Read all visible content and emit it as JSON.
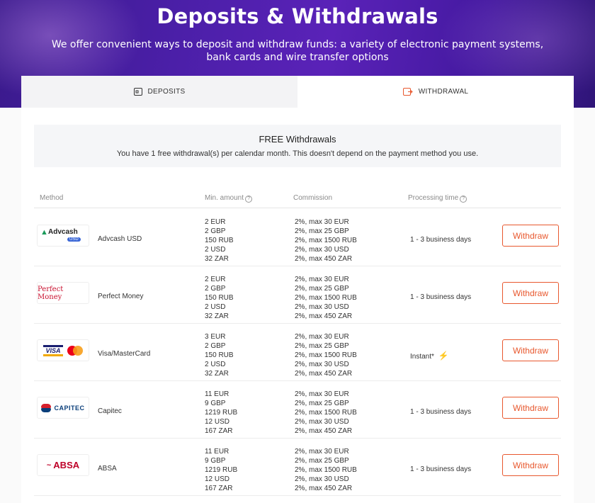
{
  "hero": {
    "title": "Deposits & Withdrawals",
    "subtitle": "We offer convenient ways to deposit and withdraw funds: a variety of electronic payment systems, bank cards and wire transfer options"
  },
  "tabs": [
    {
      "label": "DEPOSITS",
      "icon": "deposit-card-icon",
      "active": false
    },
    {
      "label": "WITHDRAWAL",
      "icon": "withdraw-card-icon",
      "active": true
    }
  ],
  "free_box": {
    "title": "FREE Withdrawals",
    "text": "You have 1 free withdrawal(s) per calendar month. This doesn't depend on the payment method you use."
  },
  "table": {
    "headers": {
      "method": "Method",
      "min_amount": "Min. amount",
      "commission": "Commission",
      "processing_time": "Processing time"
    },
    "help_glyph": "?",
    "rows": [
      {
        "name": "Advcash USD",
        "logo": {
          "text": "Advcash",
          "sub": "USD"
        },
        "min": [
          "2 EUR",
          "2 GBP",
          "150 RUB",
          "2 USD",
          "32 ZAR"
        ],
        "commission": [
          "2%, max 30 EUR",
          "2%, max 25 GBP",
          "2%, max 1500 RUB",
          "2%, max 30 USD",
          "2%, max 450 ZAR"
        ],
        "time": "1 - 3 business days",
        "button": "Withdraw"
      },
      {
        "name": "Perfect Money",
        "logo": {
          "text": "Perfect Money"
        },
        "min": [
          "2 EUR",
          "2 GBP",
          "150 RUB",
          "2 USD",
          "32 ZAR"
        ],
        "commission": [
          "2%, max 30 EUR",
          "2%, max 25 GBP",
          "2%, max 1500 RUB",
          "2%, max 30 USD",
          "2%, max 450 ZAR"
        ],
        "time": "1 - 3 business days",
        "button": "Withdraw"
      },
      {
        "name": "Visa/MasterCard",
        "logo": {
          "text": "VISA"
        },
        "min": [
          "3 EUR",
          "2 GBP",
          "150 RUB",
          "2 USD",
          "32 ZAR"
        ],
        "commission": [
          "2%, max 30 EUR",
          "2%, max 25 GBP",
          "2%, max 1500 RUB",
          "2%, max 30 USD",
          "2%, max 450 ZAR"
        ],
        "time": "Instant*",
        "time_icon": "lightning-icon",
        "button": "Withdraw"
      },
      {
        "name": "Capitec",
        "logo": {
          "text": "CAPITEC"
        },
        "min": [
          "11 EUR",
          "9 GBP",
          "1219 RUB",
          "12 USD",
          "167 ZAR"
        ],
        "commission": [
          "2%, max 30 EUR",
          "2%, max 25 GBP",
          "2%, max 1500 RUB",
          "2%, max 30 USD",
          "2%, max 450 ZAR"
        ],
        "time": "1 - 3 business days",
        "button": "Withdraw"
      },
      {
        "name": "ABSA",
        "logo": {
          "text": "ABSA"
        },
        "min": [
          "11 EUR",
          "9 GBP",
          "1219 RUB",
          "12 USD",
          "167 ZAR"
        ],
        "commission": [
          "2%, max 30 EUR",
          "2%, max 25 GBP",
          "2%, max 1500 RUB",
          "2%, max 30 USD",
          "2%, max 450 ZAR"
        ],
        "time": "1 - 3 business days",
        "button": "Withdraw"
      }
    ]
  },
  "colors": {
    "accent": "#e8582e",
    "hero_purple": "#4b1fa8"
  }
}
